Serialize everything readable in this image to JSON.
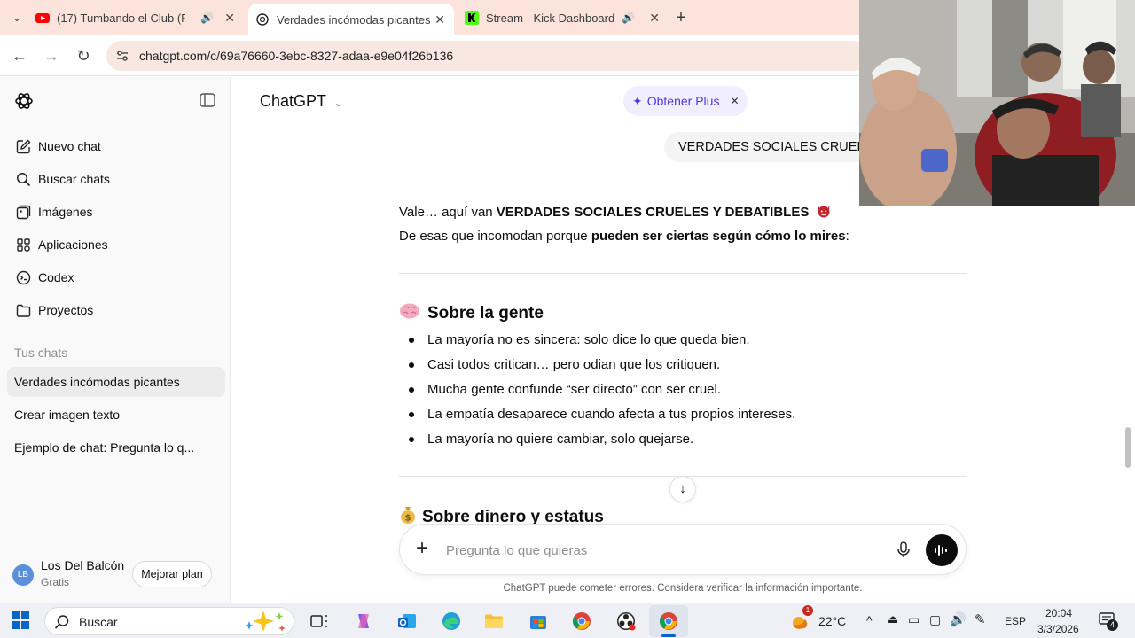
{
  "browser": {
    "tabs": [
      {
        "title": "(17) Tumbando el Club (Re",
        "active": false
      },
      {
        "title": "Verdades incómodas picantes",
        "active": true
      },
      {
        "title": "Stream - Kick Dashboard",
        "active": false
      }
    ],
    "url": "chatgpt.com/c/69a76660-3ebc-8327-adaa-e9e04f26b136"
  },
  "sidebar": {
    "nav": [
      {
        "label": "Nuevo chat",
        "icon": "new-chat-icon"
      },
      {
        "label": "Buscar chats",
        "icon": "search-icon"
      },
      {
        "label": "Imágenes",
        "icon": "images-icon"
      },
      {
        "label": "Aplicaciones",
        "icon": "apps-icon"
      },
      {
        "label": "Codex",
        "icon": "codex-icon"
      },
      {
        "label": "Proyectos",
        "icon": "folder-icon"
      }
    ],
    "section_label": "Tus chats",
    "chats": [
      {
        "label": "Verdades incómodas picantes",
        "active": true
      },
      {
        "label": "Crear imagen texto",
        "active": false
      },
      {
        "label": "Ejemplo de chat: Pregunta lo q...",
        "active": false
      }
    ],
    "user": {
      "initials": "LB",
      "name": "Los Del Balcón",
      "plan": "Gratis",
      "upgrade_label": "Mejorar plan"
    }
  },
  "header": {
    "model": "ChatGPT",
    "get_plus": "Obtener Plus"
  },
  "conversation": {
    "user_message": "VERDADES SOCIALES CRUELES",
    "intro_line1_plain": "Vale… aquí van ",
    "intro_line1_bold": "VERDADES SOCIALES CRUELES Y DEBATIBLES",
    "intro_line2_plain": "De esas que incomodan porque ",
    "intro_line2_bold": "pueden ser ciertas según cómo lo mires",
    "intro_line2_end": ":",
    "sections": [
      {
        "emoji": "brain",
        "title": "Sobre la gente",
        "bullets": [
          "La mayoría no es sincera: solo dice lo que queda bien.",
          "Casi todos critican… pero odian que los critiquen.",
          "Mucha gente confunde “ser directo” con ser cruel.",
          "La empatía desaparece cuando afecta a tus propios intereses.",
          "La mayoría no quiere cambiar, solo quejarse."
        ]
      },
      {
        "emoji": "money-bag",
        "title": "Sobre dinero y estatus",
        "bullets": []
      }
    ]
  },
  "composer": {
    "placeholder": "Pregunta lo que quieras",
    "disclaimer": "ChatGPT puede cometer errores. Considera verificar la información importante."
  },
  "taskbar": {
    "search_label": "Buscar",
    "temperature": "22°C",
    "language": "ESP",
    "time": "20:04",
    "date": "3/3/2026",
    "notification_count": "4",
    "weather_badge": "1"
  }
}
